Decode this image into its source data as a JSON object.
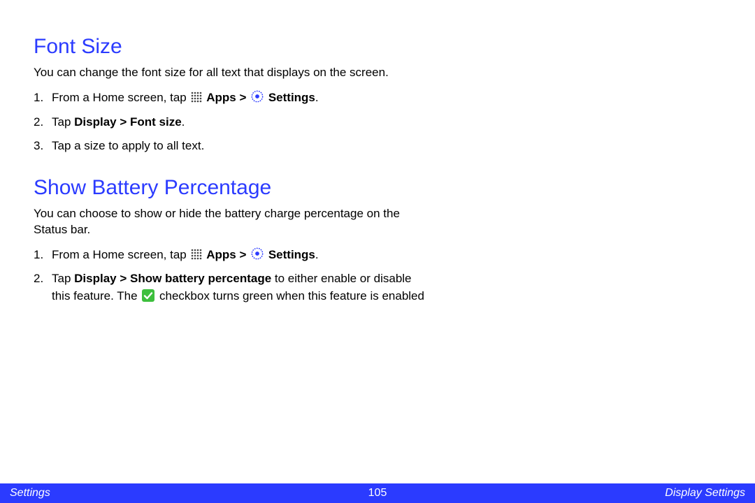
{
  "section1": {
    "heading": "Font Size",
    "intro": "You can change the font size for all text that displays on the screen.",
    "step1_a": "From a Home screen, tap ",
    "step1_apps": "Apps",
    "step1_gt": " > ",
    "step1_settings": "Settings",
    "step1_end": ".",
    "step2_a": "Tap ",
    "step2_b": "Display > Font size",
    "step2_c": ".",
    "step3": "Tap a size to apply to all text."
  },
  "section2": {
    "heading": "Show Battery Percentage",
    "intro": "You can choose to show or hide the battery charge percentage on the Status bar.",
    "step1_a": "From a Home screen, tap ",
    "step1_apps": "Apps",
    "step1_gt": " > ",
    "step1_settings": "Settings",
    "step1_end": ".",
    "step2_a": "Tap ",
    "step2_b": "Display > Show battery percentage",
    "step2_c": " to either enable or disable this feature. The ",
    "step2_d": " checkbox turns green when this feature is enabled"
  },
  "footer": {
    "left": "Settings",
    "center": "105",
    "right": "Display Settings"
  }
}
